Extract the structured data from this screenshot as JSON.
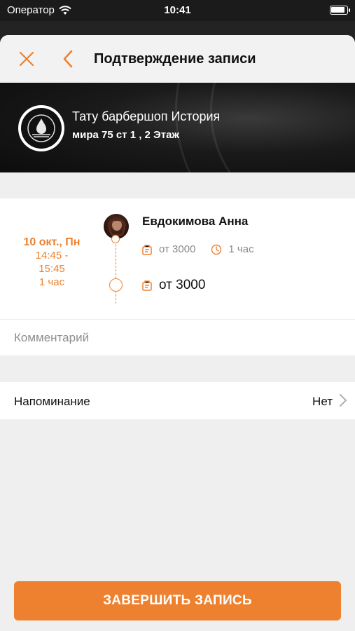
{
  "status_bar": {
    "carrier": "Оператор",
    "time": "10:41"
  },
  "header": {
    "title": "Подтверждение записи"
  },
  "salon": {
    "name": "Тату барбершоп История",
    "address": "мира 75 ст 1 , 2 Этаж"
  },
  "booking": {
    "date": "10 окт., Пн",
    "time_line1": "14:45 -",
    "time_line2": "15:45",
    "duration": "1 час",
    "master_name": "Евдокимова Анна",
    "master_price": "от 3000",
    "master_duration": "1 час",
    "total_price": "от 3000"
  },
  "comment": {
    "placeholder": "Комментарий"
  },
  "reminder": {
    "label": "Напоминание",
    "value": "Нет"
  },
  "finish_button": {
    "label": "ЗАВЕРШИТЬ ЗАПИСЬ"
  },
  "colors": {
    "accent": "#ee8130",
    "background": "#efefef"
  }
}
